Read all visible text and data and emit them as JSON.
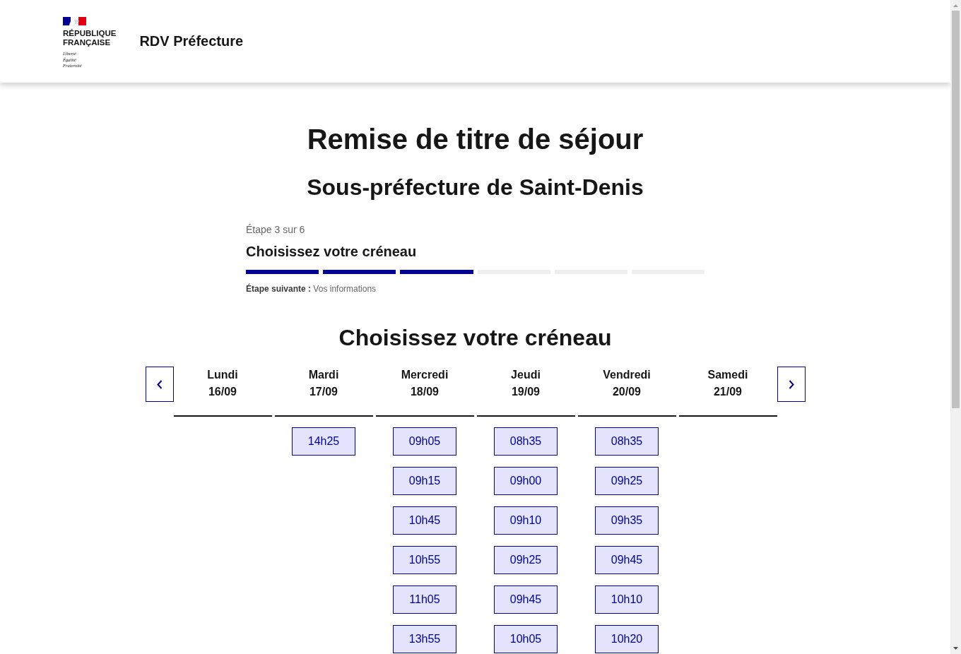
{
  "header": {
    "logo": {
      "name_lines": [
        "RÉPUBLIQUE",
        "FRANÇAISE"
      ],
      "motto_lines": [
        "Liberté",
        "Égalité",
        "Fraternité"
      ]
    },
    "service_name": "RDV Préfecture"
  },
  "page": {
    "title": "Remise de titre de séjour",
    "subtitle": "Sous-préfecture de Saint-Denis"
  },
  "stepper": {
    "step_label": "Étape 3 sur 6",
    "current_step": "Choisissez votre créneau",
    "segments": [
      {
        "completed": true
      },
      {
        "completed": true
      },
      {
        "completed": true
      },
      {
        "completed": false
      },
      {
        "completed": false
      },
      {
        "completed": false
      }
    ],
    "next_step": "**Étape suivante :** Vos informations"
  },
  "calendar": {
    "heading": "Choisissez votre créneau",
    "days": [
      {
        "name": "Lundi",
        "date": "16/09"
      },
      {
        "name": "Mardi",
        "date": "17/09",
        "slots": [
          "14h25"
        ]
      },
      {
        "name": "Mercredi",
        "date": "18/09",
        "slots": [
          "09h05",
          "09h15",
          "10h45",
          "10h55",
          "11h05",
          "13h55"
        ]
      },
      {
        "name": "Jeudi",
        "date": "19/09",
        "slots": [
          "08h35",
          "09h00",
          "09h10",
          "09h25",
          "09h45",
          "10h05"
        ]
      },
      {
        "name": "Vendredi",
        "date": "20/09",
        "slots": [
          "08h35",
          "09h25",
          "09h35",
          "09h45",
          "10h10",
          "10h20"
        ]
      },
      {
        "name": "Samedi",
        "date": "21/09"
      }
    ]
  }
}
